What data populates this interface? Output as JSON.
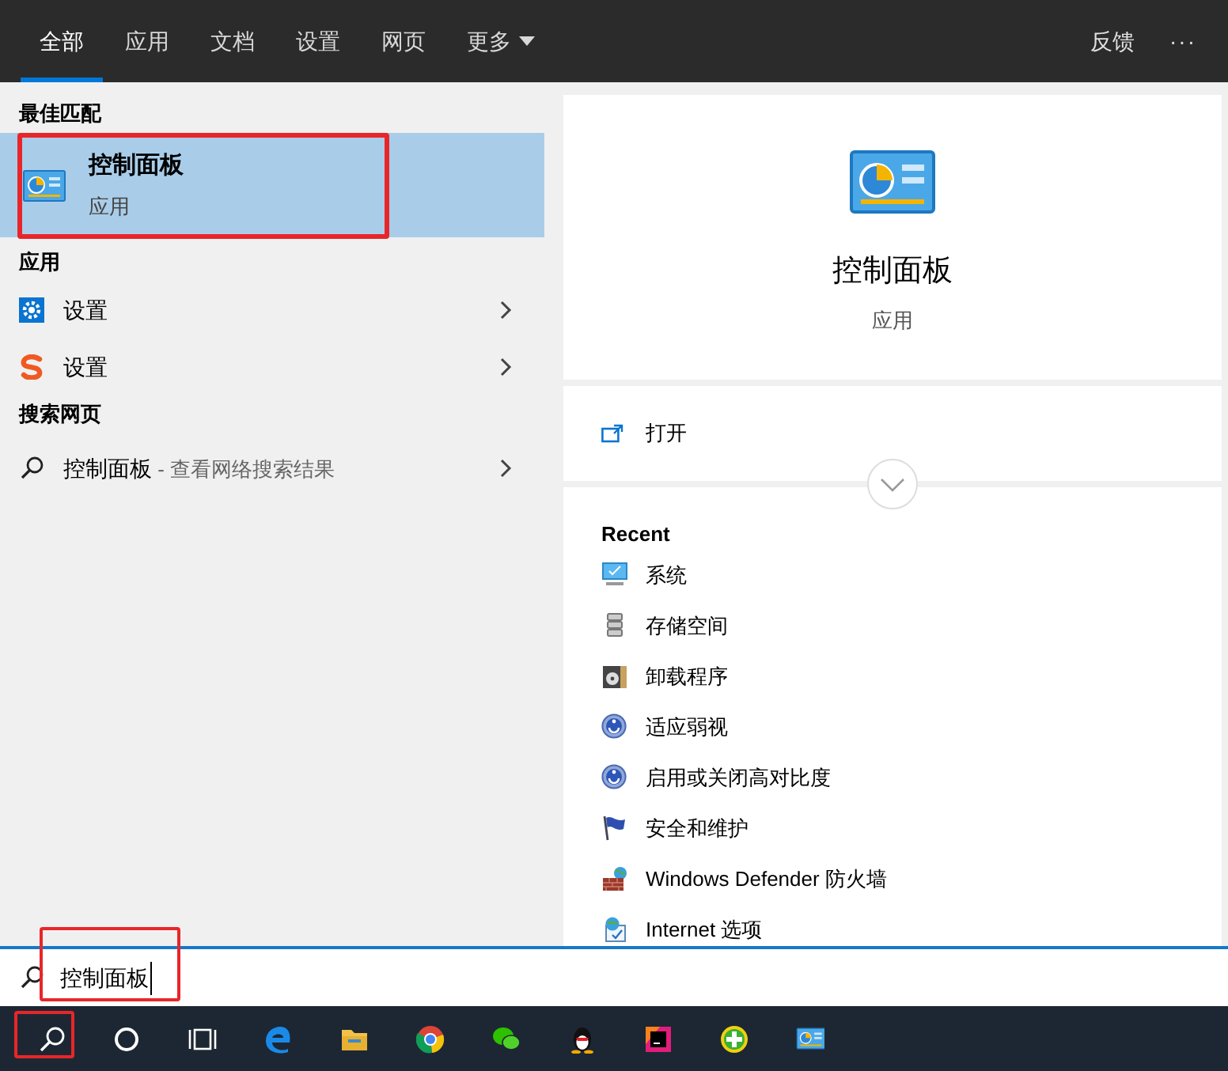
{
  "tabs": [
    {
      "label": "全部",
      "selected": true
    },
    {
      "label": "应用",
      "selected": false
    },
    {
      "label": "文档",
      "selected": false
    },
    {
      "label": "设置",
      "selected": false
    },
    {
      "label": "网页",
      "selected": false
    },
    {
      "label": "更多",
      "selected": false,
      "dropdown": true
    }
  ],
  "top_actions": {
    "feedback": "反馈",
    "more": "···"
  },
  "best_match": {
    "heading": "最佳匹配",
    "title": "控制面板",
    "subtitle": "应用",
    "selected": true,
    "annotated": true
  },
  "apps": {
    "heading": "应用",
    "items": [
      {
        "kind": "gear",
        "label": "设置"
      },
      {
        "kind": "sogou",
        "label": "设置"
      }
    ]
  },
  "web": {
    "heading": "搜索网页",
    "items": [
      {
        "label": "控制面板",
        "hint": " - 查看网络搜索结果"
      }
    ]
  },
  "detail": {
    "title": "控制面板",
    "subtitle": "应用",
    "actions": [
      {
        "label": "打开"
      }
    ],
    "recent_heading": "Recent",
    "recent": [
      {
        "kind": "system",
        "label": "系统"
      },
      {
        "kind": "storage",
        "label": "存储空间"
      },
      {
        "kind": "programs",
        "label": "卸载程序"
      },
      {
        "kind": "ease",
        "label": "适应弱视"
      },
      {
        "kind": "ease",
        "label": "启用或关闭高对比度"
      },
      {
        "kind": "flag",
        "label": "安全和维护"
      },
      {
        "kind": "firewall",
        "label": "Windows Defender 防火墙"
      },
      {
        "kind": "internet",
        "label": "Internet 选项"
      }
    ]
  },
  "search": {
    "value": "控制面板",
    "annotated": true
  },
  "taskbar": [
    {
      "kind": "search",
      "annotated": true
    },
    {
      "kind": "cortana"
    },
    {
      "kind": "taskview"
    },
    {
      "kind": "edge"
    },
    {
      "kind": "folder"
    },
    {
      "kind": "chrome"
    },
    {
      "kind": "wechat"
    },
    {
      "kind": "qq"
    },
    {
      "kind": "ide"
    },
    {
      "kind": "plus"
    },
    {
      "kind": "controlpanel"
    }
  ]
}
